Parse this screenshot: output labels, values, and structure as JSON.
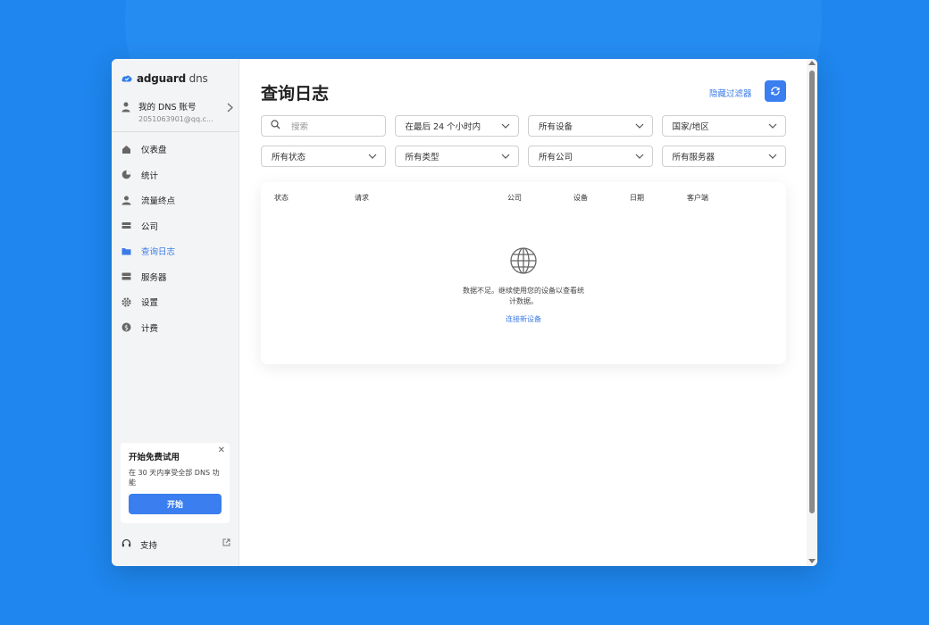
{
  "app": {
    "brand_bold": "adguard",
    "brand_light": " dns",
    "accent": "#3a7ef0",
    "background": "#1e86ee"
  },
  "account": {
    "name": "我的 DNS 账号",
    "email": "2051063901@qq.c..."
  },
  "nav": [
    {
      "label": "仪表盘",
      "icon": "home-icon",
      "active": false
    },
    {
      "label": "统计",
      "icon": "pie-chart-icon",
      "active": false
    },
    {
      "label": "流量终点",
      "icon": "user-icon",
      "active": false
    },
    {
      "label": "公司",
      "icon": "server-icon",
      "active": false
    },
    {
      "label": "查询日志",
      "icon": "folder-icon",
      "active": true
    },
    {
      "label": "服务器",
      "icon": "server-stack-icon",
      "active": false
    },
    {
      "label": "设置",
      "icon": "gear-icon",
      "active": false
    },
    {
      "label": "计费",
      "icon": "dollar-icon",
      "active": false
    }
  ],
  "trial": {
    "title": "开始免费试用",
    "description": "在 30 天内享受全部 DNS 功能",
    "button": "开始"
  },
  "support": {
    "label": "支持"
  },
  "main": {
    "title": "查询日志",
    "hide_filters": "隐藏过滤器"
  },
  "filters": {
    "search_placeholder": "搜索",
    "time": "在最后 24 个小时内",
    "devices": "所有设备",
    "country": "国家/地区",
    "status": "所有状态",
    "type": "所有类型",
    "company": "所有公司",
    "servers": "所有服务器"
  },
  "table": {
    "columns": [
      "状态",
      "请求",
      "公司",
      "设备",
      "日期",
      "客户端"
    ],
    "empty_text": "数据不足。继续使用您的设备以查看统计数据。",
    "empty_link": "连接新设备"
  }
}
